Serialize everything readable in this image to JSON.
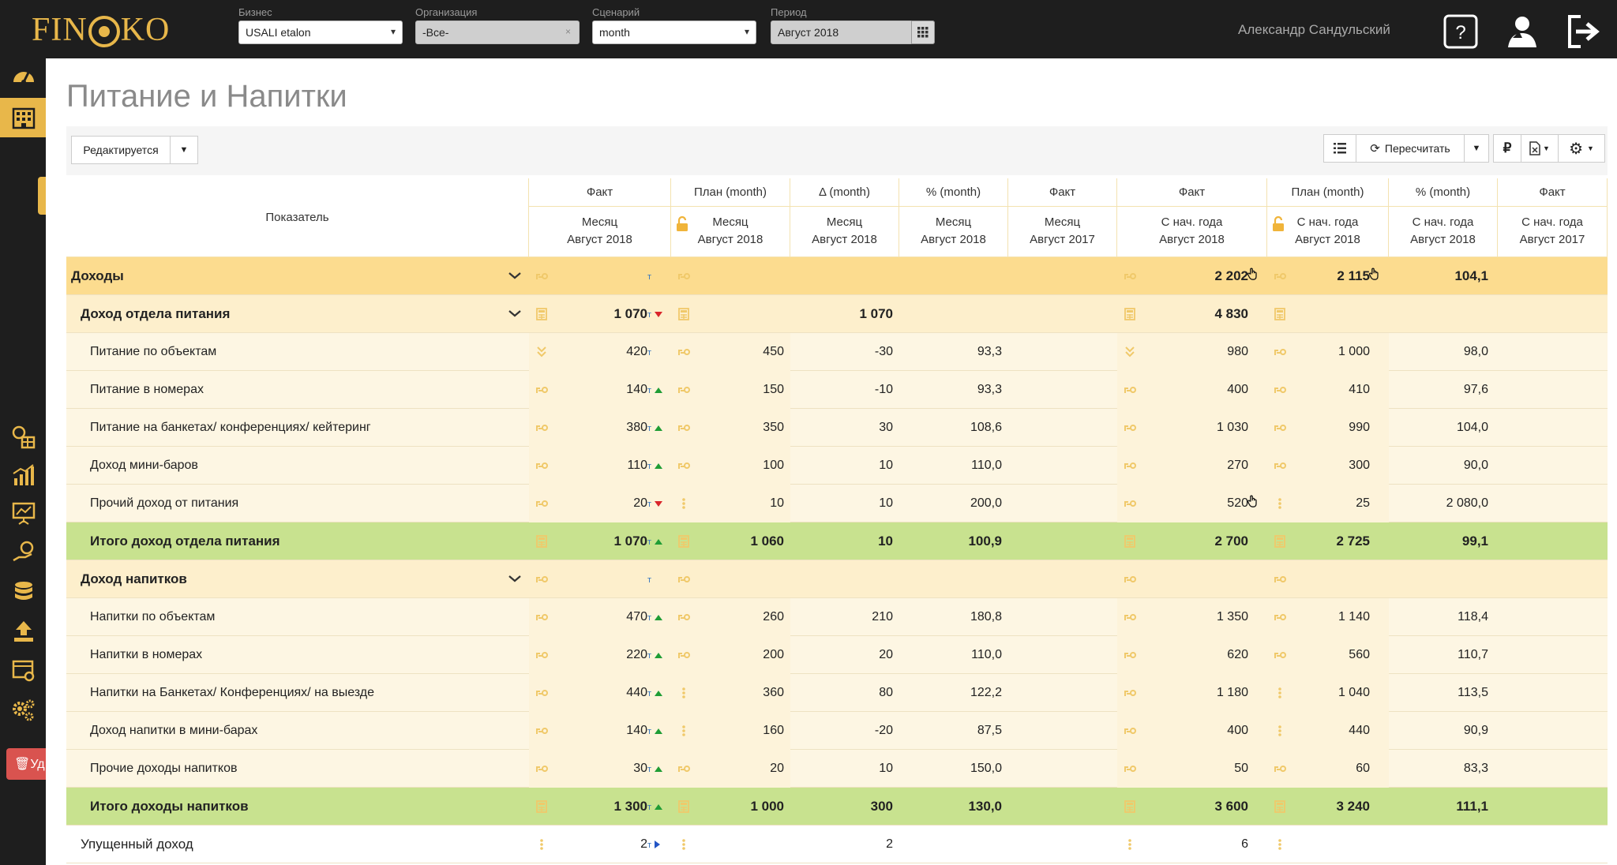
{
  "brand": {
    "logo_left": "FIN",
    "logo_right": "KO",
    "accent": "#e8b74a"
  },
  "filters": [
    {
      "label": "Бизнес",
      "value": "USALI etalon",
      "control": "select"
    },
    {
      "label": "Организация",
      "value": "-Все-",
      "control": "multiselect"
    },
    {
      "label": "Сценарий",
      "value": "month",
      "control": "select"
    },
    {
      "label": "Период",
      "value": "Август 2018",
      "control": "date"
    }
  ],
  "user": {
    "name": "Александр Сандульский"
  },
  "header_icons": [
    "help-icon",
    "user-profile-icon",
    "logout-icon"
  ],
  "sidebar": {
    "items": [
      "dashboard-icon",
      "hotel-icon",
      "coins-grid-icon",
      "chart-growth-icon",
      "presentation-chart-icon",
      "money-hand-icon",
      "database-icon",
      "upload-icon",
      "report-settings-icon",
      "settings-cogs-icon"
    ],
    "delete_label": "Уд"
  },
  "page": {
    "title": "Питание и Напитки"
  },
  "toolbar": {
    "status_label": "Редактируется",
    "recalc_label": "Пересчитать",
    "currency_symbol": "₽"
  },
  "table": {
    "indicator_header": "Показатель",
    "columns": [
      {
        "top": "Факт",
        "line1": "Месяц",
        "line2": "Август 2018",
        "lock": false
      },
      {
        "top": "План (month)",
        "line1": "Месяц",
        "line2": "Август 2018",
        "lock": true
      },
      {
        "top": "Δ (month)",
        "line1": "Месяц",
        "line2": "Август 2018",
        "lock": false
      },
      {
        "top": "% (month)",
        "line1": "Месяц",
        "line2": "Август 2018",
        "lock": false
      },
      {
        "top": "Факт",
        "line1": "Месяц",
        "line2": "Август 2017",
        "lock": false
      },
      {
        "top": "Факт",
        "line1": "С нач. года",
        "line2": "Август 2018",
        "lock": false
      },
      {
        "top": "План (month)",
        "line1": "С нач. года",
        "line2": "Август 2018",
        "lock": true
      },
      {
        "top": "% (month)",
        "line1": "С нач. года",
        "line2": "Август 2018",
        "lock": false
      },
      {
        "top": "Факт",
        "line1": "С нач. года",
        "line2": "Август 2017",
        "lock": false
      }
    ],
    "rows": [
      {
        "label": "Доходы",
        "kind": "group1",
        "collapsible": true,
        "tmark": true,
        "trend": "",
        "cells": [
          "",
          "",
          "",
          "",
          "",
          "2 202",
          "2 115",
          "104,1",
          ""
        ],
        "pointer": [
          5,
          6
        ]
      },
      {
        "label": "Доход отдела питания",
        "kind": "group2",
        "collapsible": true,
        "tmark": true,
        "trend": "down",
        "cells": [
          "1 070",
          "",
          "1 070",
          "",
          "",
          "4 830",
          "",
          "",
          ""
        ],
        "pointer": []
      },
      {
        "label": "Питание по объектам",
        "kind": "item",
        "tmark": true,
        "trend": "",
        "cells": [
          "420",
          "450",
          "-30",
          "93,3",
          "",
          "980",
          "1 000",
          "98,0",
          ""
        ],
        "pointer": []
      },
      {
        "label": "Питание в номерах",
        "kind": "item",
        "tmark": true,
        "trend": "up",
        "cells": [
          "140",
          "150",
          "-10",
          "93,3",
          "",
          "400",
          "410",
          "97,6",
          ""
        ],
        "pointer": []
      },
      {
        "label": "Питание на банкетах/ конференциях/ кейтеринг",
        "kind": "item",
        "tmark": true,
        "trend": "up",
        "cells": [
          "380",
          "350",
          "30",
          "108,6",
          "",
          "1 030",
          "990",
          "104,0",
          ""
        ],
        "pointer": []
      },
      {
        "label": "Доход мини-баров",
        "kind": "item",
        "tmark": true,
        "trend": "up",
        "cells": [
          "110",
          "100",
          "10",
          "110,0",
          "",
          "270",
          "300",
          "90,0",
          ""
        ],
        "pointer": []
      },
      {
        "label": "Прочий доход от питания",
        "kind": "item",
        "tmark": true,
        "trend": "down",
        "cells": [
          "20",
          "10",
          "10",
          "200,0",
          "",
          "520",
          "25",
          "2 080,0",
          ""
        ],
        "pointer": [
          5
        ]
      },
      {
        "label": "Итого доход отдела питания",
        "kind": "total",
        "tmark": true,
        "trend": "up",
        "cells": [
          "1 070",
          "1 060",
          "10",
          "100,9",
          "",
          "2 700",
          "2 725",
          "99,1",
          ""
        ],
        "pointer": []
      },
      {
        "label": "Доход напитков",
        "kind": "group2",
        "collapsible": true,
        "tmark": true,
        "trend": "",
        "cells": [
          "",
          "",
          "",
          "",
          "",
          "",
          "",
          "",
          ""
        ],
        "pointer": []
      },
      {
        "label": "Напитки по объектам",
        "kind": "item",
        "tmark": true,
        "trend": "up",
        "cells": [
          "470",
          "260",
          "210",
          "180,8",
          "",
          "1 350",
          "1 140",
          "118,4",
          ""
        ],
        "pointer": []
      },
      {
        "label": "Напитки в номерах",
        "kind": "item",
        "tmark": true,
        "trend": "up",
        "cells": [
          "220",
          "200",
          "20",
          "110,0",
          "",
          "620",
          "560",
          "110,7",
          ""
        ],
        "pointer": []
      },
      {
        "label": "Напитки на Банкетах/ Конференциях/ на выезде",
        "kind": "item",
        "tmark": true,
        "trend": "up",
        "cells": [
          "440",
          "360",
          "80",
          "122,2",
          "",
          "1 180",
          "1 040",
          "113,5",
          ""
        ],
        "pointer": []
      },
      {
        "label": "Доход напитки в мини-барах",
        "kind": "item",
        "tmark": true,
        "trend": "up",
        "cells": [
          "140",
          "160",
          "-20",
          "87,5",
          "",
          "400",
          "440",
          "90,9",
          ""
        ],
        "pointer": []
      },
      {
        "label": "Прочие доходы напитков",
        "kind": "item",
        "tmark": true,
        "trend": "up",
        "cells": [
          "30",
          "20",
          "10",
          "150,0",
          "",
          "50",
          "60",
          "83,3",
          ""
        ],
        "pointer": []
      },
      {
        "label": "Итого доходы напитков",
        "kind": "total",
        "tmark": true,
        "trend": "up",
        "cells": [
          "1 300",
          "1 000",
          "300",
          "130,0",
          "",
          "3 600",
          "3 240",
          "111,1",
          ""
        ],
        "pointer": []
      },
      {
        "label": "Упущенный доход",
        "kind": "plain",
        "tmark": true,
        "trend": "right",
        "cells": [
          "2",
          "",
          "2",
          "",
          "",
          "6",
          "",
          "",
          ""
        ],
        "pointer": []
      }
    ]
  },
  "colors": {
    "group1_bg": "#fcdc8f",
    "group2_bg": "#fdefcc",
    "item_bg": "#fdf6e3",
    "total_bg": "#c8e28f",
    "plain_bg": "#ffffff",
    "plan_band": "#fdf3d8"
  }
}
